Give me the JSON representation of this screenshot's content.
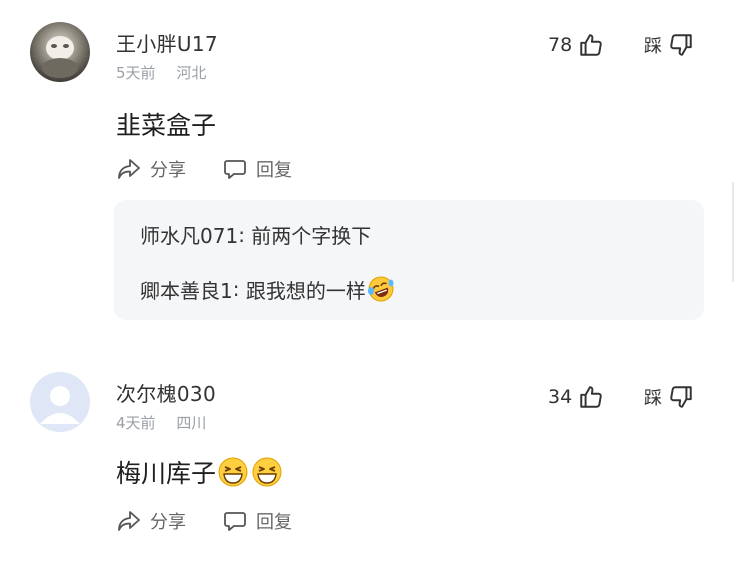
{
  "comments": [
    {
      "username": "王小胖U17",
      "time": "5天前",
      "location": "河北",
      "likes": "78",
      "dislike_label": "踩",
      "text": "韭菜盒子",
      "share_label": "分享",
      "reply_label": "回复",
      "replies": [
        {
          "author": "师水凡071",
          "separator": ": ",
          "text": "前两个字换下"
        },
        {
          "author": "卿本善良1",
          "separator": ": ",
          "text": "跟我想的一样"
        }
      ]
    },
    {
      "username": "次尔槐030",
      "time": "4天前",
      "location": "四川",
      "likes": "34",
      "dislike_label": "踩",
      "text": "梅川库子",
      "share_label": "分享",
      "reply_label": "回复"
    }
  ],
  "icons": {
    "like": "thumbs-up-icon",
    "dislike": "thumbs-down-icon",
    "share": "share-arrow-icon",
    "reply": "speech-bubble-icon",
    "emoji_laugh_cry": "laughing-crying-emoji-icon",
    "emoji_grin": "grinning-squint-emoji-icon"
  },
  "colors": {
    "text_primary": "#1f1f1f",
    "text_meta": "#9aa0a6",
    "reply_box": "#f5f6f8",
    "default_avatar": "#dfe6f5"
  }
}
